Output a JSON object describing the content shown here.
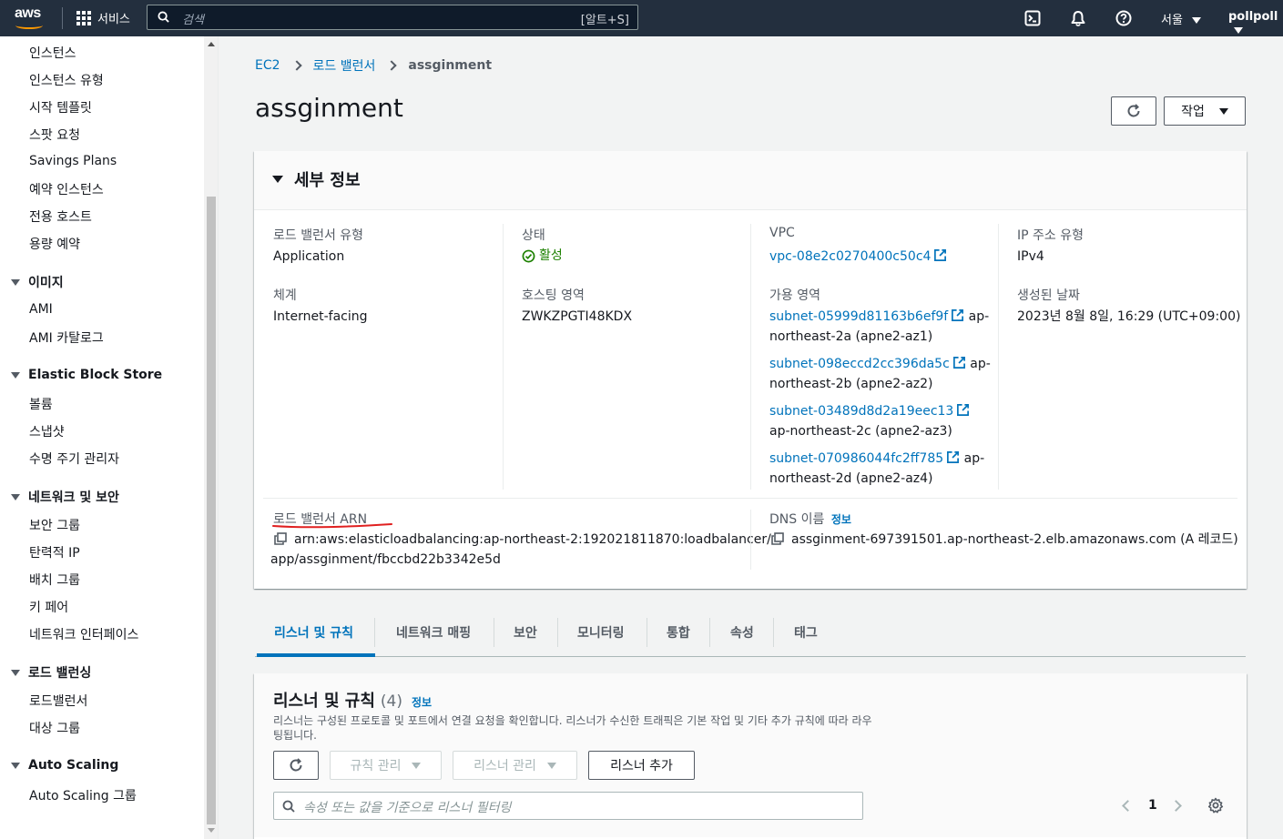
{
  "topnav": {
    "logo": "aws",
    "services_label": "서비스",
    "search_placeholder": "검색",
    "search_shortcut": "[알트+S]",
    "region": "서울",
    "user": "pollpoll",
    "icons": [
      "cloudshell-icon",
      "bell-icon",
      "help-icon"
    ]
  },
  "sidebar": {
    "items": [
      {
        "type": "item",
        "label": "인스턴스"
      },
      {
        "type": "item",
        "label": "인스턴스 유형"
      },
      {
        "type": "item",
        "label": "시작 템플릿"
      },
      {
        "type": "item",
        "label": "스팟 요청"
      },
      {
        "type": "item",
        "label": "Savings Plans"
      },
      {
        "type": "item",
        "label": "예약 인스턴스"
      },
      {
        "type": "item",
        "label": "전용 호스트"
      },
      {
        "type": "item",
        "label": "용량 예약"
      },
      {
        "type": "section",
        "label": "이미지"
      },
      {
        "type": "item",
        "label": "AMI"
      },
      {
        "type": "item",
        "label": "AMI 카탈로그"
      },
      {
        "type": "section",
        "label": "Elastic Block Store"
      },
      {
        "type": "item",
        "label": "볼륨"
      },
      {
        "type": "item",
        "label": "스냅샷"
      },
      {
        "type": "item",
        "label": "수명 주기 관리자"
      },
      {
        "type": "section",
        "label": "네트워크 및 보안"
      },
      {
        "type": "item",
        "label": "보안 그룹"
      },
      {
        "type": "item",
        "label": "탄력적 IP"
      },
      {
        "type": "item",
        "label": "배치 그룹"
      },
      {
        "type": "item",
        "label": "키 페어"
      },
      {
        "type": "item",
        "label": "네트워크 인터페이스"
      },
      {
        "type": "section",
        "label": "로드 밸런싱"
      },
      {
        "type": "item",
        "label": "로드밸런서"
      },
      {
        "type": "item",
        "label": "대상 그룹"
      },
      {
        "type": "section",
        "label": "Auto Scaling"
      },
      {
        "type": "item",
        "label": "Auto Scaling 그룹"
      }
    ]
  },
  "breadcrumb": {
    "items": [
      "EC2",
      "로드 밸런서"
    ],
    "current": "assginment"
  },
  "page": {
    "title": "assginment",
    "actions_label": "작업"
  },
  "details": {
    "heading": "세부 정보",
    "lb_type_label": "로드 밸런서 유형",
    "lb_type": "Application",
    "scheme_label": "체계",
    "scheme": "Internet-facing",
    "state_label": "상태",
    "state": "활성",
    "hosted_zone_label": "호스팅 영역",
    "hosted_zone": "ZWKZPGTI48KDX",
    "vpc_label": "VPC",
    "vpc": "vpc-08e2c0270400c50c4",
    "az_label": "가용 영역",
    "subnets": [
      {
        "id": "subnet-05999d81163b6ef9f",
        "suffix": "ap-",
        "zone": "northeast-2a (apne2-az1)"
      },
      {
        "id": "subnet-098eccd2cc396da5c",
        "suffix": "ap-",
        "zone": "northeast-2b (apne2-az2)"
      },
      {
        "id": "subnet-03489d8d2a19eec13",
        "suffix": "",
        "zone": "ap-northeast-2c (apne2-az3)"
      },
      {
        "id": "subnet-070986044fc2ff785",
        "suffix": "ap-",
        "zone": "northeast-2d (apne2-az4)"
      }
    ],
    "ip_type_label": "IP 주소 유형",
    "ip_type": "IPv4",
    "created_label": "생성된 날짜",
    "created": "2023년 8월 8일, 16:29 (UTC+09:00)",
    "arn_label": "로드 밸런서 ARN",
    "arn_line1": "arn:aws:elasticloadbalancing:ap-northeast-2:192021811870:loadbalancer/",
    "arn_line2": "app/assginment/fbccbd22b3342e5d",
    "dns_label": "DNS 이름",
    "dns_info": "정보",
    "dns": "assginment-697391501.ap-northeast-2.elb.amazonaws.com (A 레코드)"
  },
  "tabs": [
    "리스너 및 규칙",
    "네트워크 매핑",
    "보안",
    "모니터링",
    "통합",
    "속성",
    "태그"
  ],
  "listeners": {
    "title": "리스너 및 규칙",
    "count": "(4)",
    "info": "정보",
    "desc": "리스너는 구성된 프로토콜 및 포트에서 연결 요청을 확인합니다. 리스너가 수신한 트래픽은 기본 작업 및 기타 추가 규칙에 따라 라우팅됩니다.",
    "manage_rules": "규칙 관리",
    "manage_listeners": "리스너 관리",
    "add_listener": "리스너 추가",
    "filter_placeholder": "속성 또는 값을 기준으로 리스너 필터링",
    "page": "1"
  },
  "colors": {
    "nav_bg": "#232f3e",
    "link": "#0073bb",
    "success": "#1d8102",
    "annotation_red": "#e02020"
  }
}
